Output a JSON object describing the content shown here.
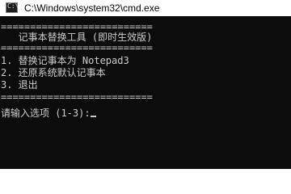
{
  "window": {
    "title": "C:\\Windows\\system32\\cmd.exe",
    "icon": "cmd-icon",
    "icon_glyph": "C:\\_"
  },
  "console": {
    "background": "#0c0c0c",
    "foreground": "#cccccc",
    "lines": [
      "==========================",
      "   记事本替换工具 (即时生效版)",
      "==========================",
      "1. 替换记事本为 Notepad3",
      "2. 还原系统默认记事本",
      "3. 退出",
      "==========================",
      "请输入选项 (1-3):"
    ]
  }
}
